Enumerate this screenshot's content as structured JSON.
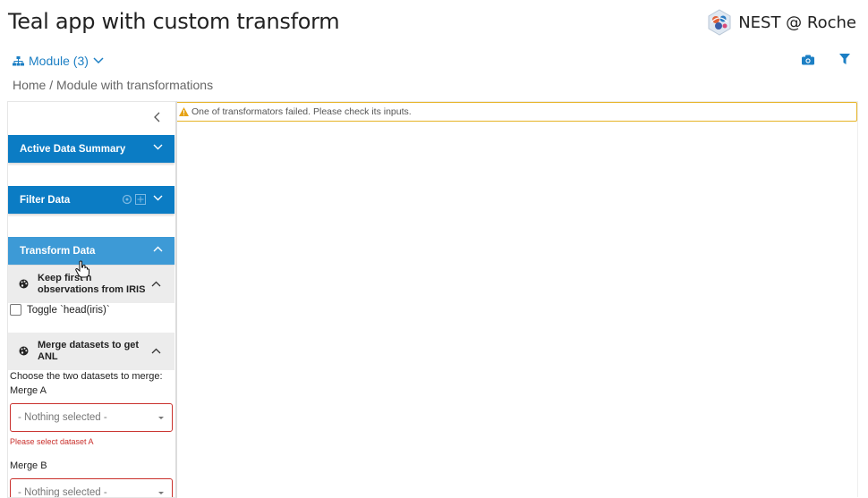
{
  "header": {
    "title": "Teal app with custom transform",
    "brand": "NEST @ Roche"
  },
  "nav": {
    "module_label": "Module (3)"
  },
  "breadcrumb": "Home / Module with transformations",
  "warning": "One of transformators failed. Please check its inputs.",
  "sidebar": {
    "active_data_summary": "Active Data Summary",
    "filter_data": "Filter Data",
    "transform_data": "Transform Data",
    "transforms": [
      {
        "title": "Keep first n observations from IRIS",
        "title_line1": "Keep first n",
        "title_line2": "observations from IRIS",
        "toggle_label": "Toggle `head(iris)`"
      },
      {
        "title": "Merge datasets to get ANL",
        "title_line1": "Merge datasets to get",
        "title_line2": "ANL",
        "prompt": "Choose the two datasets to merge:",
        "merge_a_label": "Merge A",
        "merge_a_value": "- Nothing selected -",
        "merge_a_error": "Please select dataset A",
        "merge_b_label": "Merge B",
        "merge_b_value": "- Nothing selected -"
      }
    ]
  },
  "colors": {
    "accent": "#0b7cc4",
    "accent_light": "#3d9ad6",
    "link": "#1c7fc4",
    "warning_border": "#e6b325",
    "error": "#c9302c"
  }
}
